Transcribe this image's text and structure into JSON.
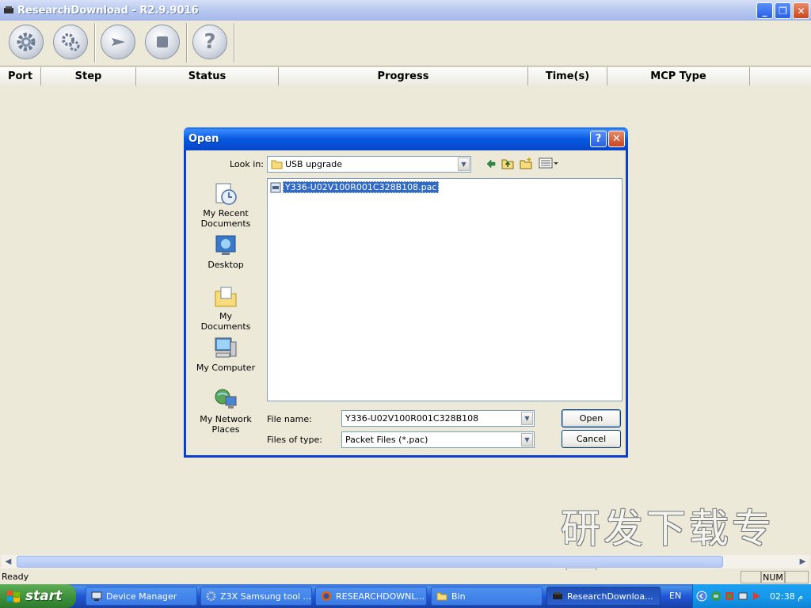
{
  "window": {
    "title": "ResearchDownload - R2.9.9016"
  },
  "toolbar": {
    "buttons": [
      {
        "name": "settings-gear-icon"
      },
      {
        "name": "multi-gear-icon"
      },
      {
        "name": "play-icon"
      },
      {
        "name": "stop-icon"
      },
      {
        "name": "help-icon",
        "glyph": "?"
      }
    ]
  },
  "columns": [
    "Port",
    "Step",
    "Status",
    "Progress",
    "Time(s)",
    "MCP Type"
  ],
  "watermark": "研发下载专用",
  "statusbar": {
    "text": "Ready",
    "num": "NUM"
  },
  "dialog": {
    "title": "Open",
    "help_glyph": "?",
    "close_glyph": "✕",
    "look_in_label": "Look in:",
    "look_in_value": "USB upgrade",
    "places": [
      {
        "label": "My Recent Documents",
        "icon": "recent-documents-icon"
      },
      {
        "label": "Desktop",
        "icon": "desktop-icon"
      },
      {
        "label": "My Documents",
        "icon": "my-documents-icon"
      },
      {
        "label": "My Computer",
        "icon": "my-computer-icon"
      },
      {
        "label": "My Network Places",
        "icon": "network-places-icon"
      }
    ],
    "files": [
      {
        "name": "Y336-U02V100R001C328B108.pac",
        "selected": true
      }
    ],
    "file_name_label": "File name:",
    "file_name_value": "Y336-U02V100R001C328B108",
    "file_type_label": "Files of type:",
    "file_type_value": "Packet Files (*.pac)",
    "open_label": "Open",
    "cancel_label": "Cancel"
  },
  "taskbar": {
    "start_label": "start",
    "tasks": [
      {
        "label": "Device Manager",
        "active": false
      },
      {
        "label": "Z3X Samsung tool ...",
        "active": false
      },
      {
        "label": "RESEARCHDOWNL...",
        "active": false
      },
      {
        "label": "Bin",
        "active": false
      },
      {
        "label": "ResearchDownloa...",
        "active": true
      }
    ],
    "lang": "EN",
    "clock": "02:38 م"
  },
  "colors": {
    "title_blue": "#0a5fe8",
    "taskbar_blue": "#2157d7",
    "start_green": "#3c8f3a",
    "selection": "#316ac5"
  }
}
